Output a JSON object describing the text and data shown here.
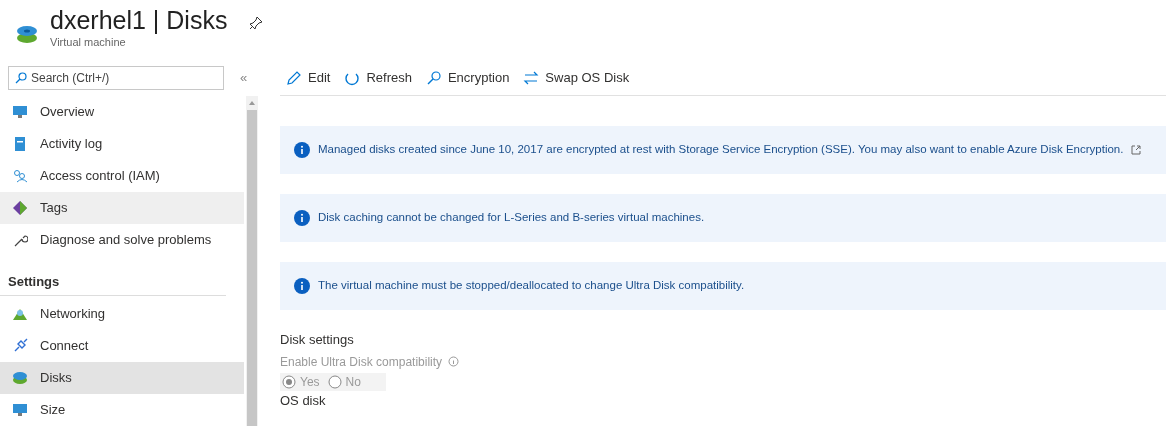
{
  "header": {
    "title": "dxerhel1 | Disks",
    "subtitle": "Virtual machine"
  },
  "sidebar": {
    "search": {
      "placeholder": "Search (Ctrl+/)"
    },
    "collapse": "«",
    "items": [
      {
        "kind": "item",
        "label": "Overview",
        "selected": false,
        "hovered": false
      },
      {
        "kind": "item",
        "label": "Activity log",
        "selected": false,
        "hovered": false
      },
      {
        "kind": "item",
        "label": "Access control (IAM)",
        "selected": false,
        "hovered": false
      },
      {
        "kind": "item",
        "label": "Tags",
        "selected": false,
        "hovered": true
      },
      {
        "kind": "item",
        "label": "Diagnose and solve problems",
        "selected": false,
        "hovered": false
      },
      {
        "kind": "section",
        "label": "Settings"
      },
      {
        "kind": "item",
        "label": "Networking",
        "selected": false,
        "hovered": false
      },
      {
        "kind": "item",
        "label": "Connect",
        "selected": false,
        "hovered": false
      },
      {
        "kind": "item",
        "label": "Disks",
        "selected": true,
        "hovered": false
      },
      {
        "kind": "item",
        "label": "Size",
        "selected": false,
        "hovered": false
      }
    ]
  },
  "toolbar": [
    "Edit",
    "Refresh",
    "Encryption",
    "Swap OS Disk"
  ],
  "banners": [
    {
      "text": "Managed disks created since June 10, 2017 are encrypted at rest with Storage Service Encryption (SSE). You may also want to enable Azure Disk Encryption.",
      "external_link": true
    },
    {
      "text": "Disk caching cannot be changed for L-Series and B-series virtual machines.",
      "external_link": false
    },
    {
      "text": "The virtual machine must be stopped/deallocated to change Ultra Disk compatibility.",
      "external_link": false
    }
  ],
  "disk_settings": {
    "heading": "Disk settings",
    "ultra_label": "Enable Ultra Disk compatibility",
    "disabled": true,
    "options": [
      {
        "label": "Yes",
        "selected": true
      },
      {
        "label": "No",
        "selected": false
      }
    ]
  },
  "os_disk": "OS disk"
}
